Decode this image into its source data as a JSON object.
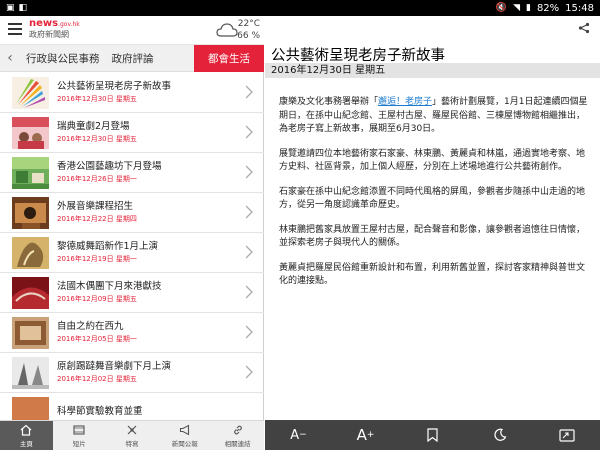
{
  "status_bar": {
    "battery": "82%",
    "time": "15:48"
  },
  "header": {
    "logo_main": "news",
    "logo_suffix": ".gov.hk",
    "logo_sub": "政府新聞網",
    "temperature": "22°C",
    "humidity": "66 %"
  },
  "tabs": [
    {
      "label": "行政與公民事務"
    },
    {
      "label": "政府評論"
    },
    {
      "label": "都會生活"
    }
  ],
  "news_list": [
    {
      "title": "公共藝術呈現老房子新故事",
      "date": "2016年12月30日 星期五"
    },
    {
      "title": "瑞典童劇2月登場",
      "date": "2016年12月30日 星期五"
    },
    {
      "title": "香港公園藝趣坊下月登場",
      "date": "2016年12月26日 星期一"
    },
    {
      "title": "外展音樂課程招生",
      "date": "2016年12月22日 星期四"
    },
    {
      "title": "黎德威舞蹈新作1月上演",
      "date": "2016年12月19日 星期一"
    },
    {
      "title": "法國木偶團下月來港獻技",
      "date": "2016年12月09日 星期五"
    },
    {
      "title": "自由之約在西九",
      "date": "2016年12月05日 星期一"
    },
    {
      "title": "原創踢躂舞音樂劇下月上演",
      "date": "2016年12月02日 星期五"
    },
    {
      "title": "科學節實驗教育並重",
      "date": ""
    }
  ],
  "bottom_nav": [
    {
      "label": "主頁",
      "icon": "home-icon"
    },
    {
      "label": "短片",
      "icon": "film-icon"
    },
    {
      "label": "特寫",
      "icon": "feature-icon"
    },
    {
      "label": "新聞公報",
      "icon": "megaphone-icon"
    },
    {
      "label": "相關連結",
      "icon": "link-icon"
    }
  ],
  "article": {
    "title": "公共藝術呈現老房子新故事",
    "date": "2016年12月30日 星期五",
    "p1_a": "康樂及文化事務署舉辦「",
    "p1_link": "邂逅！老房子",
    "p1_b": "」藝術計劃展覽，1月1日起連續四個星期日，在孫中山紀念館、王屋村古屋、羅屋民俗館、三棟屋博物館相繼推出，為老房子寫上新故事，展期至6月30日。",
    "p2": "展覽邀請四位本地藝術家石家豪、林東鵬、黃麗貞和林嵐，通過實地考察、地方史料、社區背景，加上個人經歷，分別在上述場地進行公共藝術創作。",
    "p3": "石家豪在孫中山紀念館添置不同時代風格的屏風，參觀者步隨孫中山走過的地方，從另一角度認識革命歷史。",
    "p4": "林東鵬把舊家具放置王屋村古屋，配合聲音和影像，讓參觀者追憶往日情懷，並探索老房子與現代人的關係。",
    "p5": "黃麗貞把羅屋民俗館重新設計和布置，利用新舊並置，探討客家精神與普世文化的連接點。"
  },
  "toolbar": {
    "font_minus": "A",
    "font_plus": "A",
    "minus_sign": "−",
    "plus_sign": "+"
  },
  "colors": {
    "accent": "#e4233a",
    "link": "#1c7bd1",
    "toolbar": "#424242"
  }
}
